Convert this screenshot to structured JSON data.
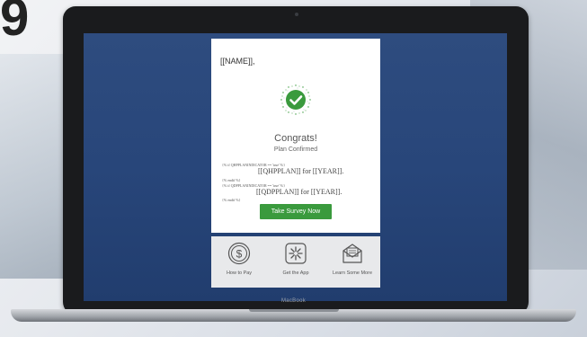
{
  "hero_text": "9",
  "laptop": {
    "brand": "MacBook"
  },
  "email": {
    "greeting": "[[NAME]],",
    "badge_icon": "checkmark-icon",
    "title": "Congrats!",
    "subtitle": "Plan Confirmed",
    "template": {
      "if_qhp": "{% if QHPPLANINDICATOR == 'true' %}",
      "qhp_line": "[[QHPPLAN]] for [[YEAR]].",
      "endif_1": "{% endif %}",
      "if_qdp": "{% if QDPPLANINDICATOR == 'true' %}",
      "qdp_line": "[[QDPPLAN]] for [[YEAR]].",
      "endif_2": "{% endif %}"
    },
    "cta_label": "Take Survey Now",
    "colors": {
      "cta": "#3a9a3d",
      "screen_bg": "#28467a"
    }
  },
  "footer": {
    "items": [
      {
        "label": "How to Pay",
        "icon": "dollar-coin-icon"
      },
      {
        "label": "Get the App",
        "icon": "app-logo-icon"
      },
      {
        "label": "Learn Some More",
        "icon": "envelope-icon"
      }
    ]
  }
}
